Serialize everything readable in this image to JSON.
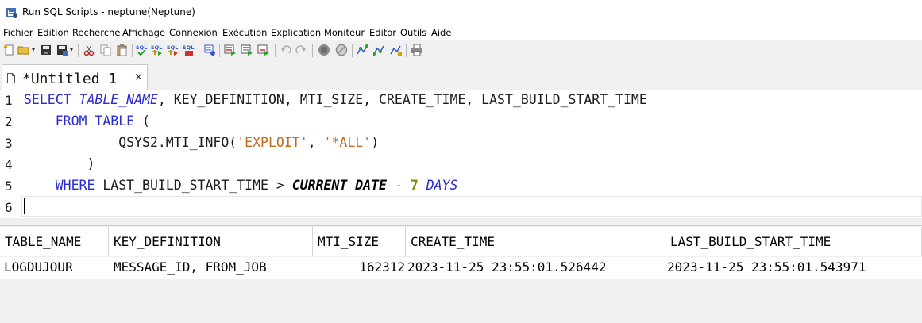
{
  "window": {
    "title": "Run SQL Scripts - neptune(Neptune)",
    "icon": "run-sql-scripts-icon"
  },
  "menu": [
    "Fichier",
    "Edition",
    "Recherche",
    "Affichage",
    "Connexion",
    "Exécution",
    "Explication",
    "Moniteur",
    "Editor",
    "Outils",
    "Aide"
  ],
  "toolbar": {
    "icons": [
      "new-script-icon",
      "open-icon",
      "save-icon",
      "save-as-icon",
      "cut-icon",
      "copy-icon",
      "paste-icon",
      "sql-check-icon",
      "sql-run-icon",
      "sql-run-all-icon",
      "sql-insert-icon",
      "connect-icon",
      "run-all-icon",
      "run-from-selected-icon",
      "run-selected-icon",
      "undo-icon",
      "redo-icon",
      "stop-icon",
      "cancel-icon",
      "explain-icon",
      "visual-explain-icon",
      "explain-run-icon",
      "print-icon"
    ],
    "sql_label": "SQL"
  },
  "tab": {
    "label": "*Untitled 1",
    "close": "×"
  },
  "editor": {
    "line_numbers": [
      "1",
      "2",
      "3",
      "4",
      "5",
      "6"
    ],
    "tokens": {
      "l1_select": "SELECT",
      "l1_table_name": "TABLE_NAME",
      "l1_rest": ", KEY_DEFINITION, MTI_SIZE, CREATE_TIME, LAST_BUILD_START_TIME",
      "l2_indent": "    ",
      "l2_from": "FROM",
      "l2_table": "TABLE",
      "l2_paren": " (",
      "l3_func": "            QSYS2.MTI_INFO(",
      "l3_str1": "'EXPLOIT'",
      "l3_comma": ", ",
      "l3_str2": "'*ALL'",
      "l3_close": ")",
      "l4": "        )",
      "l5_indent": "    ",
      "l5_where": "WHERE",
      "l5_col": " LAST_BUILD_START_TIME > ",
      "l5_current": "CURRENT DATE",
      "l5_minus": "-",
      "l5_num": "7",
      "l5_days": "DAYS"
    }
  },
  "results": {
    "columns": [
      "TABLE_NAME",
      "KEY_DEFINITION",
      "MTI_SIZE",
      "CREATE_TIME",
      "LAST_BUILD_START_TIME"
    ],
    "rows": [
      [
        "LOGDUJOUR",
        "MESSAGE_ID, FROM_JOB",
        "162312",
        "2023-11-25 23:55:01.526442",
        "2023-11-25 23:55:01.543971"
      ]
    ]
  },
  "colors": {
    "keyword": "#2b2bd6",
    "string": "#c46a1c",
    "number": "#8a8a00"
  }
}
